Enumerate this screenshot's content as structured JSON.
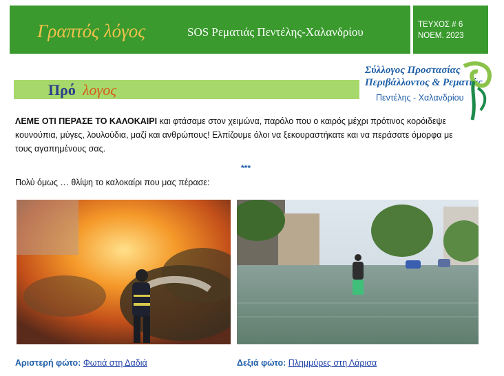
{
  "header": {
    "title": "Γραπτός λόγος",
    "subtitle": "SOS Ρεματιάς Πεντέλης-Χαλανδρίου",
    "issue": "ΤΕΥΧΟΣ # 6",
    "date": "ΝΟΕΜ. 2023"
  },
  "logo": {
    "line1": "Σύλλογος Προστασίας",
    "line2": "Περιβάλλοντος & Ρεματιάς",
    "line3": "Πεντέλης - Χαλανδρίου"
  },
  "section": {
    "word1": "Πρό",
    "word2": "λογος"
  },
  "body": {
    "lead": "ΛΕΜΕ ΟΤΙ ΠΕΡΑΣΕ ΤΟ ΚΑΛΟΚΑΙΡΙ",
    "text": " και φτάσαμε στον χειμώνα, παρόλο που ο καιρός μέχρι πρότινος κορόιδεψε κουνούπια, μύγες, λουλούδια, μαζί και ανθρώπους! Ελπίζουμε όλοι να ξεκουραστήκατε και να περάσατε όμορφα με τους αγαπημένους σας.",
    "separator": "***",
    "second": "Πολύ όμως … θλίψη το καλοκαίρι που μας πέρασε:"
  },
  "captions": {
    "left_key": "Αριστερή φώτο:",
    "left_value": "Φωτιά στη Δαδιά",
    "right_key": "Δεξιά φώτο:",
    "right_value": "Πλημμύρες στη Λάρισα"
  }
}
